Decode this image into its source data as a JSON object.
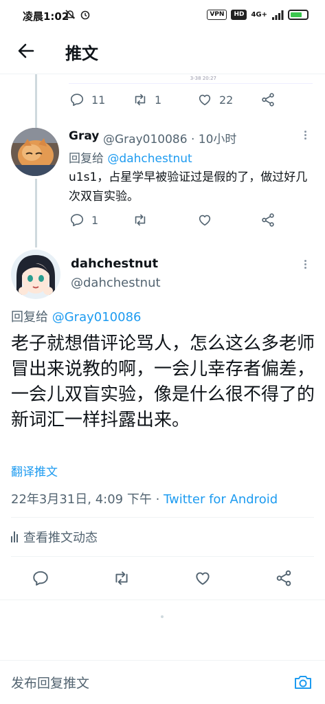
{
  "status_bar": {
    "time": "凌晨1:02",
    "vpn": "VPN",
    "hd": "HD",
    "network": "4G+"
  },
  "header": {
    "title": "推文"
  },
  "previous_tweet": {
    "stub_text": "3-38 20:27",
    "reply_count": "11",
    "retweet_count": "1",
    "like_count": "22"
  },
  "reply_tweet": {
    "name": "Gray",
    "handle_time": "@Gray010086 · 10小时",
    "replying_prefix": "回复给",
    "replying_to": "@dahchestnut",
    "body": "u1s1，占星学早被验证过是假的了，做过好几次双盲实验。",
    "reply_count": "1"
  },
  "main_tweet": {
    "name": "dahchestnut",
    "handle": "@dahchestnut",
    "replying_prefix": "回复给",
    "replying_to": "@Gray010086",
    "body": "老子就想借评论骂人，怎么这么多老师冒出来说教的啊，一会儿幸存者偏差，一会儿双盲实验，像是什么很不得了的新词汇一样抖露出来。",
    "translate": "翻译推文",
    "timestamp": "22年3月31日, 4:09 下午 · ",
    "source": "Twitter for Android",
    "activity": "查看推文动态"
  },
  "composer": {
    "placeholder": "发布回复推文"
  },
  "colors": {
    "accent": "#1d9bf0",
    "secondary_text": "#536471",
    "thread_line": "#cfd9de"
  },
  "icons": [
    "back-arrow-icon",
    "reply-icon",
    "retweet-icon",
    "like-icon",
    "share-icon",
    "more-icon",
    "camera-icon",
    "bar-chart-icon"
  ]
}
